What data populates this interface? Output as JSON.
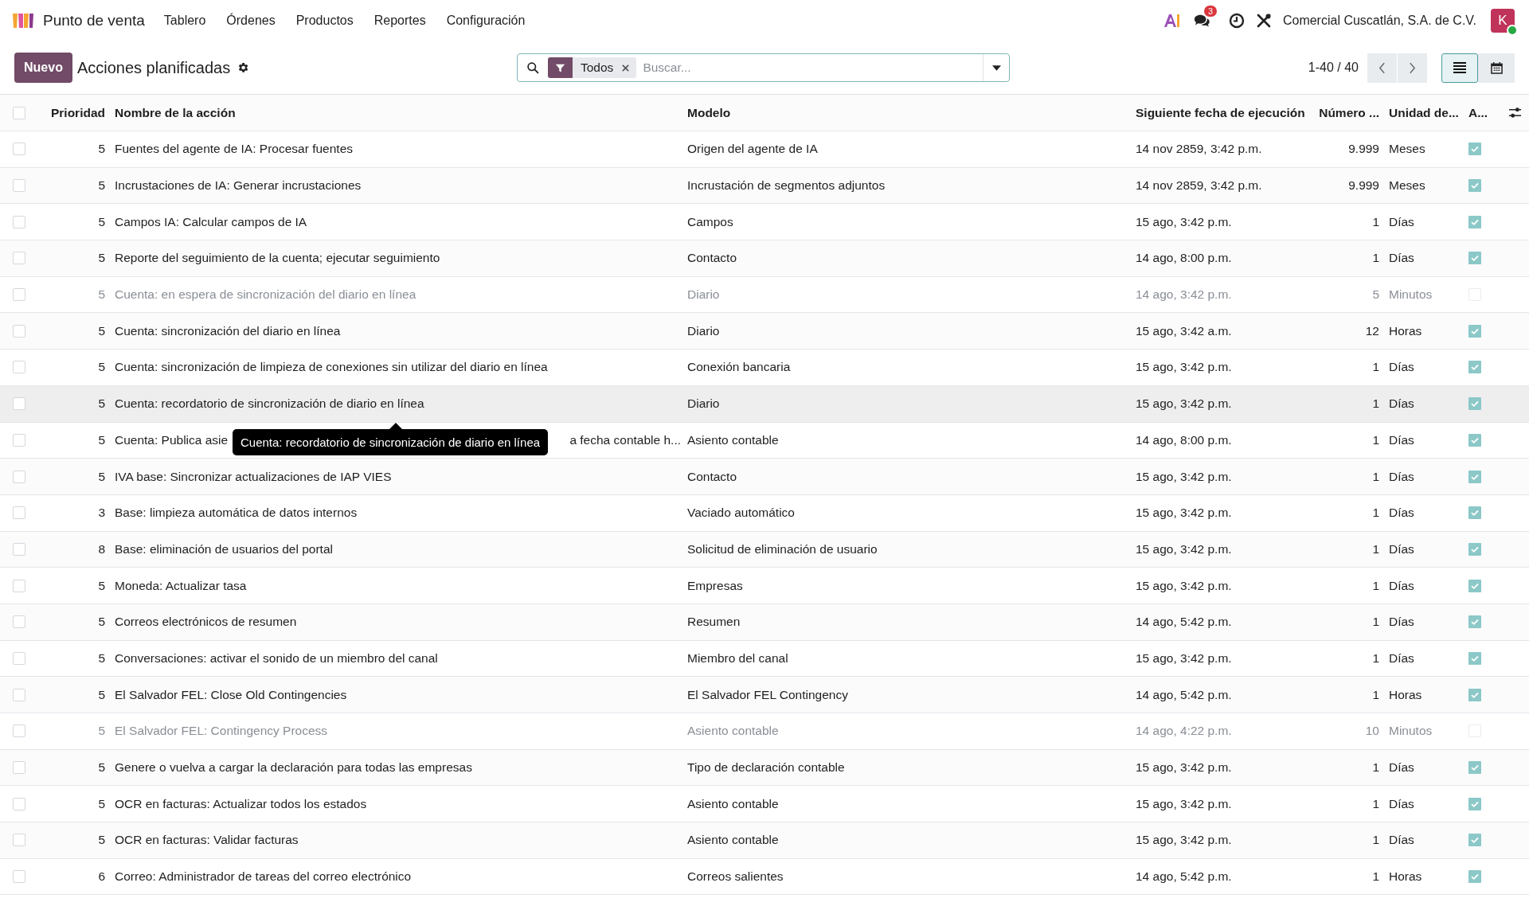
{
  "app": {
    "name": "Punto de venta"
  },
  "menu": [
    {
      "label": "Tablero"
    },
    {
      "label": "Órdenes"
    },
    {
      "label": "Productos"
    },
    {
      "label": "Reportes"
    },
    {
      "label": "Configuración"
    }
  ],
  "systray": {
    "messages_badge": "3",
    "company": "Comercial Cuscatlán, S.A. de C.V.",
    "avatar_initial": "K",
    "online": true
  },
  "control_panel": {
    "new_button": "Nuevo",
    "title": "Acciones planificadas",
    "search": {
      "facet": "Todos",
      "placeholder": "Buscar..."
    },
    "pager": "1-40 / 40",
    "views": [
      {
        "kind": "list",
        "selected": true
      },
      {
        "kind": "calendar",
        "selected": false
      }
    ]
  },
  "table": {
    "all_selected": false,
    "columns": [
      "Prioridad",
      "Nombre de la acción",
      "Modelo",
      "Siguiente fecha de ejecución",
      "Número ...",
      "Unidad de...",
      "A..."
    ],
    "rows": [
      {
        "priority": "5",
        "name": "Fuentes del agente de IA: Procesar fuentes",
        "model": "Origen del agente de IA",
        "next_date": "14 nov 2859, 3:42 p.m.",
        "interval": "9.999",
        "unit": "Meses",
        "active": true,
        "selected": false,
        "highlighted": false
      },
      {
        "priority": "5",
        "name": "Incrustaciones de IA: Generar incrustaciones",
        "model": "Incrustación de segmentos adjuntos",
        "next_date": "14 nov 2859, 3:42 p.m.",
        "interval": "9.999",
        "unit": "Meses",
        "active": true,
        "selected": false,
        "highlighted": false
      },
      {
        "priority": "5",
        "name": "Campos IA: Calcular campos de IA",
        "model": "Campos",
        "next_date": "15 ago, 3:42 p.m.",
        "interval": "1",
        "unit": "Días",
        "active": true,
        "selected": false,
        "highlighted": false
      },
      {
        "priority": "5",
        "name": "Reporte del seguimiento de la cuenta; ejecutar seguimiento",
        "model": "Contacto",
        "next_date": "14 ago, 8:00 p.m.",
        "interval": "1",
        "unit": "Días",
        "active": true,
        "selected": false,
        "highlighted": false
      },
      {
        "priority": "5",
        "name": "Cuenta: en espera de sincronización del diario en línea",
        "model": "Diario",
        "next_date": "14 ago, 3:42 p.m.",
        "interval": "5",
        "unit": "Minutos",
        "active": false,
        "selected": false,
        "highlighted": false
      },
      {
        "priority": "5",
        "name": "Cuenta: sincronización del diario en línea",
        "model": "Diario",
        "next_date": "15 ago, 3:42 a.m.",
        "interval": "12",
        "unit": "Horas",
        "active": true,
        "selected": false,
        "highlighted": false
      },
      {
        "priority": "5",
        "name": "Cuenta: sincronización de limpieza de conexiones sin utilizar del diario en línea",
        "model": "Conexión bancaria",
        "next_date": "15 ago, 3:42 p.m.",
        "interval": "1",
        "unit": "Días",
        "active": true,
        "selected": false,
        "highlighted": false
      },
      {
        "priority": "5",
        "name": "Cuenta: recordatorio de sincronización de diario en línea",
        "model": "Diario",
        "next_date": "15 ago, 3:42 p.m.",
        "interval": "1",
        "unit": "Días",
        "active": true,
        "selected": false,
        "highlighted": true,
        "tooltip": "Cuenta: recordatorio de sincronización de diario en línea"
      },
      {
        "priority": "5",
        "name": "Cuenta: Publica asie",
        "name_end": "a fecha contable h...",
        "model": "Asiento contable",
        "next_date": "14 ago, 8:00 p.m.",
        "interval": "1",
        "unit": "Días",
        "active": true,
        "selected": false,
        "highlighted": false
      },
      {
        "priority": "5",
        "name": "IVA base: Sincronizar actualizaciones de IAP VIES",
        "model": "Contacto",
        "next_date": "15 ago, 3:42 p.m.",
        "interval": "1",
        "unit": "Días",
        "active": true,
        "selected": false,
        "highlighted": false
      },
      {
        "priority": "3",
        "name": "Base: limpieza automática de datos internos",
        "model": "Vaciado automático",
        "next_date": "15 ago, 3:42 p.m.",
        "interval": "1",
        "unit": "Días",
        "active": true,
        "selected": false,
        "highlighted": false
      },
      {
        "priority": "8",
        "name": "Base: eliminación de usuarios del portal",
        "model": "Solicitud de eliminación de usuario",
        "next_date": "15 ago, 3:42 p.m.",
        "interval": "1",
        "unit": "Días",
        "active": true,
        "selected": false,
        "highlighted": false
      },
      {
        "priority": "5",
        "name": "Moneda: Actualizar tasa",
        "model": "Empresas",
        "next_date": "15 ago, 3:42 p.m.",
        "interval": "1",
        "unit": "Días",
        "active": true,
        "selected": false,
        "highlighted": false
      },
      {
        "priority": "5",
        "name": "Correos electrónicos de resumen",
        "model": "Resumen",
        "next_date": "14 ago, 5:42 p.m.",
        "interval": "1",
        "unit": "Días",
        "active": true,
        "selected": false,
        "highlighted": false
      },
      {
        "priority": "5",
        "name": "Conversaciones: activar el sonido de un miembro del canal",
        "model": "Miembro del canal",
        "next_date": "15 ago, 3:42 p.m.",
        "interval": "1",
        "unit": "Días",
        "active": true,
        "selected": false,
        "highlighted": false
      },
      {
        "priority": "5",
        "name": "El Salvador FEL: Close Old Contingencies",
        "model": "El Salvador FEL Contingency",
        "next_date": "14 ago, 5:42 p.m.",
        "interval": "1",
        "unit": "Horas",
        "active": true,
        "selected": false,
        "highlighted": false
      },
      {
        "priority": "5",
        "name": "El Salvador FEL: Contingency Process",
        "model": "Asiento contable",
        "next_date": "14 ago, 4:22 p.m.",
        "interval": "10",
        "unit": "Minutos",
        "active": false,
        "selected": false,
        "highlighted": false
      },
      {
        "priority": "5",
        "name": "Genere o vuelva a cargar la declaración para todas las empresas",
        "model": "Tipo de declaración contable",
        "next_date": "15 ago, 3:42 p.m.",
        "interval": "1",
        "unit": "Días",
        "active": true,
        "selected": false,
        "highlighted": false
      },
      {
        "priority": "5",
        "name": "OCR en facturas: Actualizar todos los estados",
        "model": "Asiento contable",
        "next_date": "15 ago, 3:42 p.m.",
        "interval": "1",
        "unit": "Días",
        "active": true,
        "selected": false,
        "highlighted": false
      },
      {
        "priority": "5",
        "name": "OCR en facturas: Validar facturas",
        "model": "Asiento contable",
        "next_date": "15 ago, 3:42 p.m.",
        "interval": "1",
        "unit": "Días",
        "active": true,
        "selected": false,
        "highlighted": false
      },
      {
        "priority": "6",
        "name": "Correo: Administrador de tareas del correo electrónico",
        "model": "Correos salientes",
        "next_date": "14 ago, 5:42 p.m.",
        "interval": "1",
        "unit": "Horas",
        "active": true,
        "selected": false,
        "highlighted": false
      }
    ]
  }
}
